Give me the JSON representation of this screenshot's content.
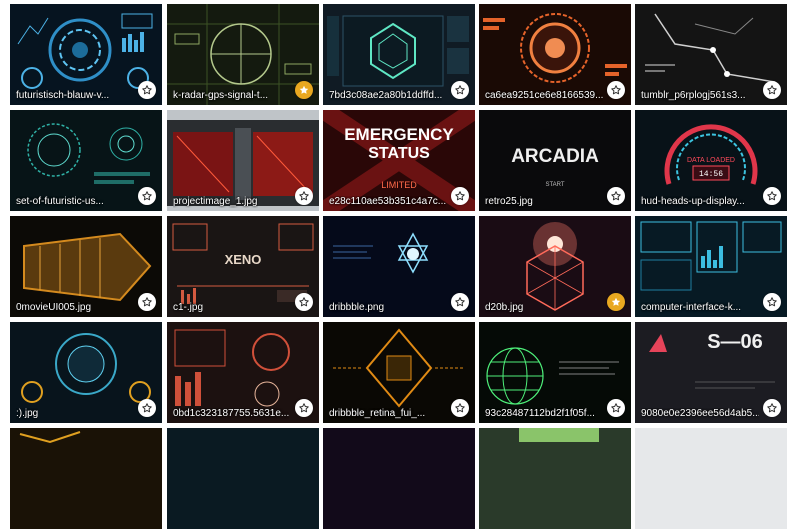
{
  "gallery": {
    "tiles": [
      {
        "filename": "futuristisch-blauw-v...",
        "favorite": false
      },
      {
        "filename": "k-radar-gps-signal-t...",
        "favorite": true
      },
      {
        "filename": "7bd3c08ae2a80b1ddffd...",
        "favorite": false
      },
      {
        "filename": "ca6ea9251ce6e8166539...",
        "favorite": false
      },
      {
        "filename": "tumblr_p6rplogj561s3...",
        "favorite": false
      },
      {
        "filename": "set-of-futuristic-us...",
        "favorite": false
      },
      {
        "filename": "projectimage_1.jpg",
        "favorite": false
      },
      {
        "filename": "e28c110ae53b351c4a7c...",
        "favorite": false
      },
      {
        "filename": "retro25.jpg",
        "favorite": false
      },
      {
        "filename": "hud-heads-up-display...",
        "favorite": false
      },
      {
        "filename": "0movieUI005.jpg",
        "favorite": false
      },
      {
        "filename": "c1-.jpg",
        "favorite": false
      },
      {
        "filename": "dribbble.png",
        "favorite": false
      },
      {
        "filename": "d20b.jpg",
        "favorite": true
      },
      {
        "filename": "computer-interface-k...",
        "favorite": false
      },
      {
        "filename": ":).jpg",
        "favorite": false
      },
      {
        "filename": "0bd1c323187755.5631e...",
        "favorite": false
      },
      {
        "filename": "dribbble_retina_fui_...",
        "favorite": false
      },
      {
        "filename": "93c28487112bd2f1f05f...",
        "favorite": false
      },
      {
        "filename": "9080e0e2396ee56d4ab5...",
        "favorite": false
      },
      {
        "filename": "",
        "favorite": false
      },
      {
        "filename": "",
        "favorite": false
      },
      {
        "filename": "",
        "favorite": false
      },
      {
        "filename": "",
        "favorite": false
      },
      {
        "filename": "",
        "favorite": false
      }
    ]
  },
  "thumb_texts": {
    "emergency": "EMERGENCY",
    "status": "STATUS",
    "limited": "LIMITED",
    "arcadia": "ARCADIA",
    "start": "START",
    "data_loaded": "DATA LOADED",
    "clock": "14:56",
    "xeno": "XENO",
    "s06": "S—06"
  },
  "icons": {
    "star": "star-icon",
    "star_filled": "star-filled-icon"
  },
  "colors": {
    "favorite_active": "#e9a820",
    "favorite_inactive": "#ffffff"
  }
}
